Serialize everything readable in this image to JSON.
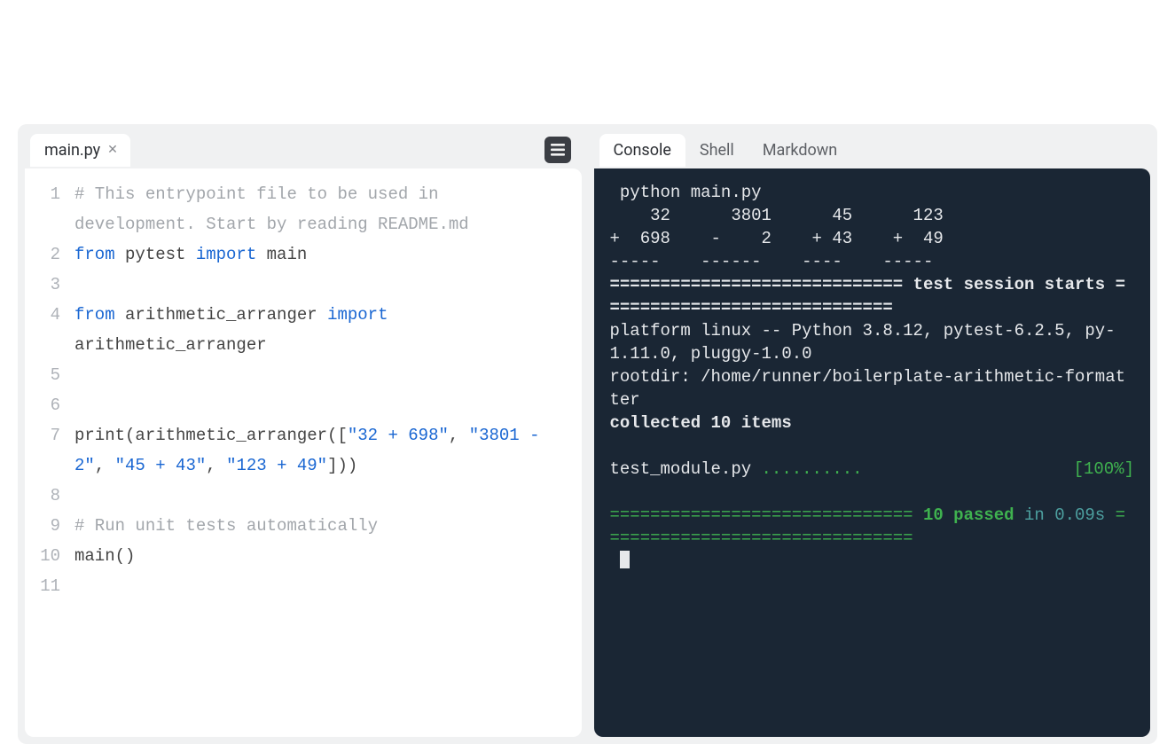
{
  "editor": {
    "tab": {
      "filename": "main.py"
    },
    "lines": [
      [
        {
          "cls": "tok-comment",
          "t": "# This entrypoint file to be used in development. Start by reading README.md"
        }
      ],
      [
        {
          "cls": "tok-kw",
          "t": "from"
        },
        {
          "cls": "",
          "t": " pytest "
        },
        {
          "cls": "tok-kw",
          "t": "import"
        },
        {
          "cls": "",
          "t": " main"
        }
      ],
      [
        {
          "cls": "",
          "t": ""
        }
      ],
      [
        {
          "cls": "tok-kw",
          "t": "from"
        },
        {
          "cls": "",
          "t": " arithmetic_arranger "
        },
        {
          "cls": "tok-kw",
          "t": "import"
        },
        {
          "cls": "",
          "t": " arithmetic_arranger"
        }
      ],
      [
        {
          "cls": "",
          "t": ""
        }
      ],
      [
        {
          "cls": "",
          "t": ""
        }
      ],
      [
        {
          "cls": "",
          "t": "print(arithmetic_arranger(["
        },
        {
          "cls": "tok-str",
          "t": "\"32 + 698\""
        },
        {
          "cls": "",
          "t": ", "
        },
        {
          "cls": "tok-str",
          "t": "\"3801 - 2\""
        },
        {
          "cls": "",
          "t": ", "
        },
        {
          "cls": "tok-str",
          "t": "\"45 + 43\""
        },
        {
          "cls": "",
          "t": ", "
        },
        {
          "cls": "tok-str",
          "t": "\"123 + 49\""
        },
        {
          "cls": "",
          "t": "]))"
        }
      ],
      [
        {
          "cls": "",
          "t": ""
        }
      ],
      [
        {
          "cls": "tok-comment",
          "t": "# Run unit tests automatically"
        }
      ],
      [
        {
          "cls": "",
          "t": "main()"
        }
      ],
      [
        {
          "cls": "",
          "t": ""
        }
      ]
    ]
  },
  "rightTabs": {
    "items": [
      "Console",
      "Shell",
      "Markdown"
    ],
    "activeIndex": 0
  },
  "console": {
    "prompt_char": "",
    "command": "python main.py",
    "row1": "    32      3801      45      123",
    "row2": "+  698    -    2    + 43    +  49",
    "row3": "-----    ------    ----    -----",
    "sess_prefix": "============================= ",
    "sess_label": "test session starts",
    "sess_suffix": " =============================",
    "platform": "platform linux -- Python 3.8.12, pytest-6.2.5, py-1.11.0, pluggy-1.0.0",
    "rootdir": "rootdir: /home/runner/boilerplate-arithmetic-formatter",
    "collected": "collected 10 items",
    "collected_num": "",
    "testfile": "test_module.py ",
    "dots": "..........",
    "percent": "[100%]",
    "pass_prefix": "============================== ",
    "pass_label": "10 passed",
    "pass_mid": " in 0.09s",
    "pass_suffix": " ==============================="
  },
  "colors": {
    "prompt": "#c58f3a",
    "green": "#3fb24f",
    "dimteal": "#4da0a0",
    "consoleBg": "#1a2634"
  }
}
